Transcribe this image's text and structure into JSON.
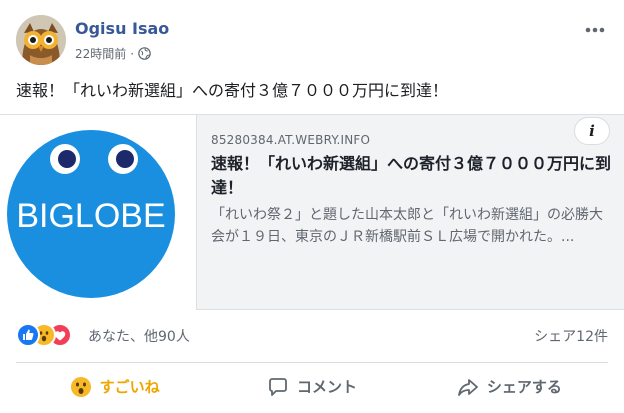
{
  "post": {
    "author": "Ogisu Isao",
    "time": "22時間前",
    "separator": "·",
    "privacy_icon": "globe-icon",
    "more_icon": "more-dots-icon",
    "text": "速報！「れいわ新選組」への寄付３億７０００万円に到達！"
  },
  "link_card": {
    "thumbnail_brand": "BIGLOBE",
    "thumbnail_color": "#1a8fe0",
    "info_label": "i",
    "domain": "85280384.AT.WEBRY.INFO",
    "title": "速報！「れいわ新選組」への寄付３億７０００万円に到達！",
    "description": "「れいわ祭２」と題した山本太郎と「れいわ新選組」の必勝大会が１９日、東京のＪＲ新橋駅前ＳＬ広場で開かれた。..."
  },
  "reactions": {
    "icons": [
      "like-reaction-icon",
      "wow-reaction-icon",
      "love-reaction-icon"
    ],
    "summary": "あなた、他90人",
    "shares": "シェア12件"
  },
  "actions": {
    "react_label": "すごいね",
    "comment_label": "コメント",
    "share_label": "シェアする"
  },
  "colors": {
    "author": "#385898",
    "like": "#1877f2",
    "wow": "#f7b928",
    "love": "#f33e58",
    "active_reaction": "#f0a500"
  }
}
